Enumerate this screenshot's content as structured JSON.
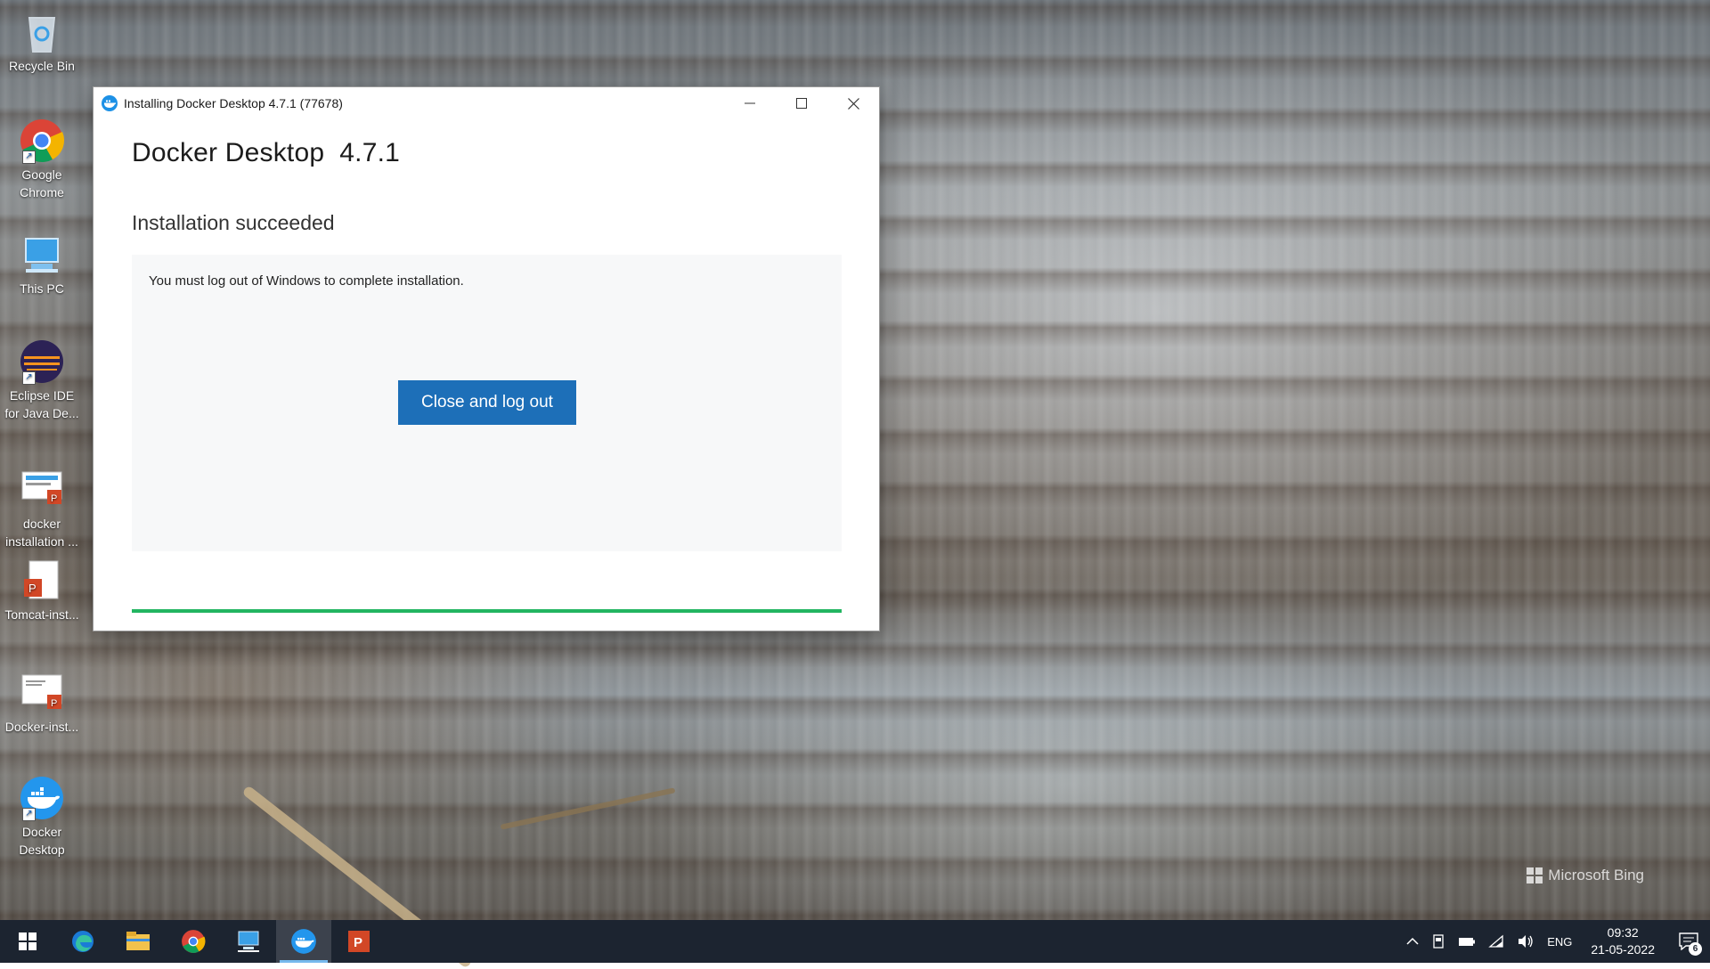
{
  "desktop": {
    "icons": [
      {
        "label": "Recycle Bin",
        "icon": "recycle-bin-icon"
      },
      {
        "label": "Google Chrome",
        "icon": "chrome-icon"
      },
      {
        "label": "This PC",
        "icon": "computer-icon"
      },
      {
        "label": "Eclipse IDE for Java De...",
        "icon": "eclipse-icon"
      },
      {
        "label": "docker installation ...",
        "icon": "powerpoint-file-icon"
      },
      {
        "label": "Tomcat-inst...",
        "icon": "powerpoint-file-icon"
      },
      {
        "label": "Docker-inst...",
        "icon": "powerpoint-file-icon"
      },
      {
        "label": "Docker Desktop",
        "icon": "docker-icon"
      }
    ],
    "wallpaper_credit": "Microsoft Bing"
  },
  "installer": {
    "window_title": "Installing Docker Desktop 4.7.1 (77678)",
    "product_title": "Docker Desktop  4.7.1",
    "status": "Installation succeeded",
    "message": "You must log out of Windows to complete installation.",
    "primary_button": "Close and log out",
    "progress_percent": 100,
    "accent_color": "#1d6fb8",
    "progress_color": "#22b561"
  },
  "taskbar": {
    "items": [
      "start-icon",
      "edge-icon",
      "file-explorer-icon",
      "chrome-icon",
      "remote-desktop-icon",
      "docker-icon",
      "powerpoint-icon"
    ],
    "active_item": "docker-icon",
    "tray": {
      "language": "ENG",
      "time": "09:32",
      "date": "21-05-2022",
      "notification_count": "6"
    }
  }
}
